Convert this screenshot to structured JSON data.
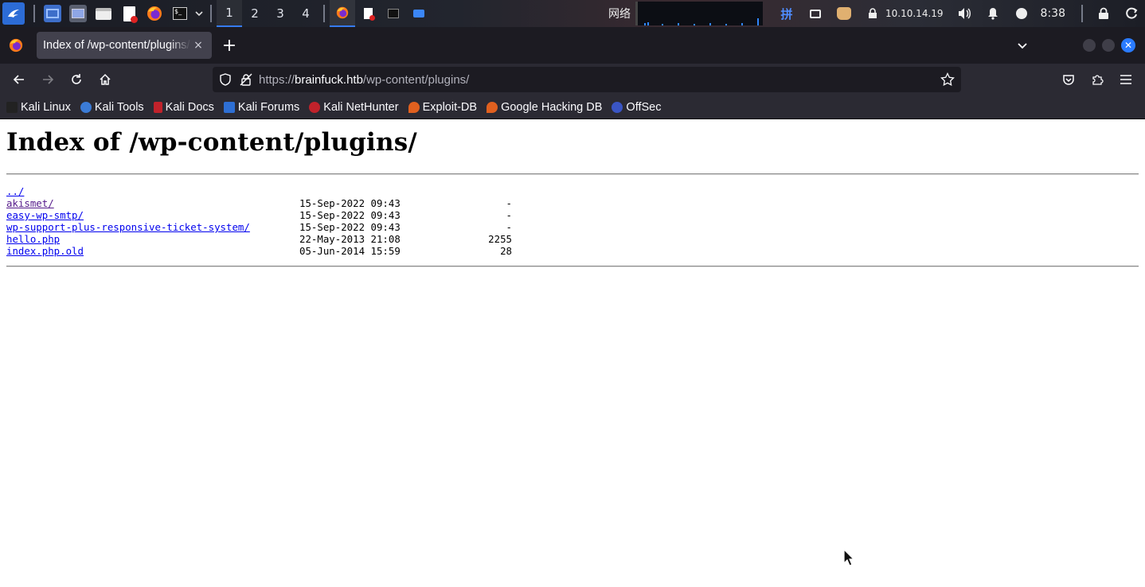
{
  "panel": {
    "workspaces": [
      "1",
      "2",
      "3",
      "4"
    ],
    "network_label": "网络",
    "ime_label": "拼",
    "ip": "10.10.14.19",
    "time": "8:38"
  },
  "tab": {
    "title": "Index of /wp-content/plugins/",
    "close": "×",
    "new_tab": "+"
  },
  "urlbar": {
    "scheme": "https://",
    "host": "brainfuck.htb",
    "path": "/wp-content/plugins/"
  },
  "bookmarks": [
    {
      "label": "Kali Linux",
      "icon": "kali-dragon-icon",
      "color": "#222222"
    },
    {
      "label": "Kali Tools",
      "icon": "kali-tools-icon",
      "color": "#3b7bd6"
    },
    {
      "label": "Kali Docs",
      "icon": "kali-docs-icon",
      "color": "#c0222b"
    },
    {
      "label": "Kali Forums",
      "icon": "kali-forums-icon",
      "color": "#2e6fd4"
    },
    {
      "label": "Kali NetHunter",
      "icon": "nethunter-icon",
      "color": "#c0222b"
    },
    {
      "label": "Exploit-DB",
      "icon": "exploit-db-icon",
      "color": "#e0601f"
    },
    {
      "label": "Google Hacking DB",
      "icon": "ghdb-icon",
      "color": "#e0601f"
    },
    {
      "label": "OffSec",
      "icon": "offsec-icon",
      "color": "#3a55c4"
    }
  ],
  "page": {
    "heading": "Index of /wp-content/plugins/",
    "entries": [
      {
        "name": "../",
        "date": "",
        "size": "",
        "visited": false
      },
      {
        "name": "akismet/",
        "date": "15-Sep-2022 09:43",
        "size": "-",
        "visited": true
      },
      {
        "name": "easy-wp-smtp/",
        "date": "15-Sep-2022 09:43",
        "size": "-",
        "visited": false
      },
      {
        "name": "wp-support-plus-responsive-ticket-system/",
        "date": "15-Sep-2022 09:43",
        "size": "-",
        "visited": false
      },
      {
        "name": "hello.php",
        "date": "22-May-2013 21:08",
        "size": "2255",
        "visited": false
      },
      {
        "name": "index.php.old",
        "date": "05-Jun-2014 15:59",
        "size": "28",
        "visited": false
      }
    ]
  },
  "colors": {
    "link": "#0000ee",
    "visited": "#551a8b",
    "accent": "#367bf0"
  }
}
